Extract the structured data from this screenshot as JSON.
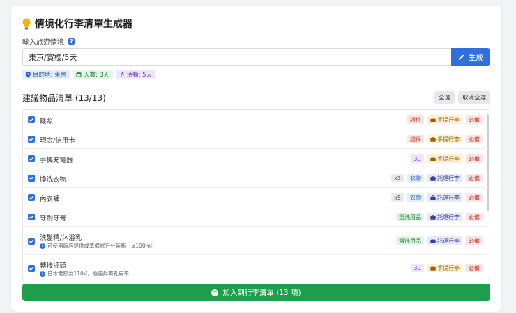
{
  "header": {
    "title": "情境化行李清單生成器",
    "icon": "lightbulb-icon"
  },
  "trip": {
    "label": "輸入旅遊情境",
    "value": "東京/賞櫻/5天",
    "generate_label": "生成"
  },
  "chips": [
    {
      "icon": "map-pin-icon",
      "text": "目的地: 東京"
    },
    {
      "icon": "calendar-icon",
      "text": "天數: 3天"
    },
    {
      "icon": "activity-icon",
      "text": "活動: 5天"
    }
  ],
  "list": {
    "title": "建議物品清單 (13/13)",
    "select_all": "全選",
    "deselect_all": "取消全選",
    "items": [
      {
        "name": "護照",
        "checked": true,
        "badges": [
          {
            "text": "證件",
            "style": "red"
          },
          {
            "text": "手提行李",
            "style": "orange",
            "icon": "briefcase-icon"
          },
          {
            "text": "必備",
            "style": "red"
          }
        ]
      },
      {
        "name": "現金/信用卡",
        "checked": true,
        "badges": [
          {
            "text": "證件",
            "style": "red"
          },
          {
            "text": "手提行李",
            "style": "orange",
            "icon": "briefcase-icon"
          },
          {
            "text": "必備",
            "style": "red"
          }
        ]
      },
      {
        "name": "手機充電器",
        "checked": true,
        "badges": [
          {
            "text": "3C",
            "style": "purple"
          },
          {
            "text": "手提行李",
            "style": "orange",
            "icon": "briefcase-icon"
          },
          {
            "text": "必備",
            "style": "red"
          }
        ]
      },
      {
        "name": "換洗衣物",
        "checked": true,
        "badges": [
          {
            "text": "x3",
            "style": "gray"
          },
          {
            "text": "衣物",
            "style": "blue"
          },
          {
            "text": "託運行李",
            "style": "indigo",
            "icon": "suitcase-icon"
          },
          {
            "text": "必備",
            "style": "red"
          }
        ]
      },
      {
        "name": "內衣褲",
        "checked": true,
        "badges": [
          {
            "text": "x5",
            "style": "gray"
          },
          {
            "text": "衣物",
            "style": "blue"
          },
          {
            "text": "託運行李",
            "style": "indigo",
            "icon": "suitcase-icon"
          },
          {
            "text": "必備",
            "style": "red"
          }
        ]
      },
      {
        "name": "牙刷牙膏",
        "checked": true,
        "badges": [
          {
            "text": "盥洗用品",
            "style": "green"
          },
          {
            "text": "託運行李",
            "style": "indigo",
            "icon": "suitcase-icon"
          },
          {
            "text": "必備",
            "style": "red"
          }
        ]
      },
      {
        "name": "洗髮精/沐浴乳",
        "checked": true,
        "note": "可使用飯店提供或準備旅行分裝瓶（≤100ml）",
        "badges": [
          {
            "text": "盥洗用品",
            "style": "green"
          },
          {
            "text": "託運行李",
            "style": "indigo",
            "icon": "suitcase-icon"
          },
          {
            "text": "必備",
            "style": "red"
          }
        ]
      },
      {
        "name": "轉接插頭",
        "checked": true,
        "note": "日本電壓為110V，插座為兩孔扁平",
        "badges": [
          {
            "text": "3C",
            "style": "purple"
          },
          {
            "text": "手提行李",
            "style": "orange",
            "icon": "briefcase-icon"
          },
          {
            "text": "必備",
            "style": "red"
          }
        ]
      }
    ]
  },
  "add_button": {
    "label": "加入到行李清單 (13 項)"
  },
  "colors": {
    "primary": "#2f6fe0",
    "success": "#1e9e4a"
  }
}
